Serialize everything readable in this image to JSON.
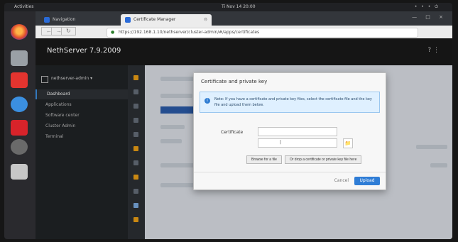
{
  "topbar": {
    "activities": "Activities",
    "clock": "Ti Nov 14 20:00",
    "system": "• • • ⏻"
  },
  "browser": {
    "tabs": [
      "Navigation",
      "Certificate Manager"
    ],
    "url": "https://192.168.1.10/nethserver/cluster-admin/#/apps/certificates",
    "new_tab": "+",
    "window_controls": "— □ ×",
    "nav": {
      "back": "←",
      "forward": "→",
      "reload": "↻"
    }
  },
  "app": {
    "title": "NethServer 7.9.2009",
    "help": "? ⋮",
    "context": "nethserver-admin ▾",
    "menu": [
      "Dashboard",
      "Applications",
      "Software center",
      "Cluster Admin",
      "Terminal"
    ],
    "active_menu_index": 0
  },
  "modal": {
    "title": "Certificate and private key",
    "notice_icon": "i",
    "notice": "Note: If you have a certificate and private key files, select the certificate file and the key file and upload them below.",
    "label_cert": "Certificate",
    "file_value": "|",
    "browse_icon": "📁",
    "buttons": [
      "Browse for a file",
      "Or drop a certificate or private key file here"
    ],
    "cancel": "Cancel",
    "submit": "Upload"
  }
}
